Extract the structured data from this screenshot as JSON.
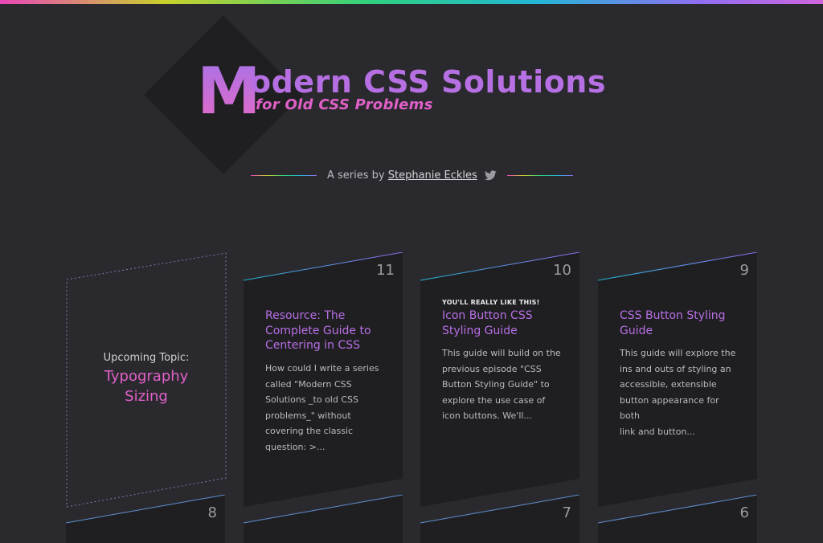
{
  "header": {
    "logo_letter": "M",
    "title_rest": "odern CSS Solutions",
    "subtitle": "for Old CSS Problems"
  },
  "byline": {
    "prefix": "A series by",
    "author": "Stephanie Eckles",
    "icon": "twitter-icon"
  },
  "upcoming": {
    "label": "Upcoming Topic:",
    "topic_line1": "Typography",
    "topic_line2": "Sizing"
  },
  "cards": [
    {
      "number": "11",
      "kicker": "",
      "title_lines": [
        "Resource: The",
        "Complete Guide to",
        "Centering in CSS"
      ],
      "text_lines": [
        "How could I write a series",
        "called \"Modern CSS",
        "Solutions _to old CSS",
        "problems_\" without",
        "covering the classic",
        "question: >..."
      ]
    },
    {
      "number": "10",
      "kicker": "You'll really like this!",
      "title_lines": [
        "Icon Button CSS",
        "Styling Guide"
      ],
      "text_lines": [
        "This guide will build on the",
        "previous episode \"CSS",
        "Button Styling Guide\" to",
        "explore the use case of",
        "icon buttons. We'll..."
      ]
    },
    {
      "number": "9",
      "kicker": "",
      "title_lines": [
        "CSS Button Styling",
        "Guide"
      ],
      "text_lines": [
        "This guide will explore the",
        "ins and outs of styling an",
        "accessible, extensible",
        "button appearance for both",
        "link and button..."
      ]
    }
  ],
  "bottom_numbers": [
    "8",
    "7",
    "6"
  ],
  "colors": {
    "background": "#2a2a2e",
    "card": "#1f1f22",
    "accent_purple": "#b86fe4",
    "accent_pink": "#e060c8"
  }
}
